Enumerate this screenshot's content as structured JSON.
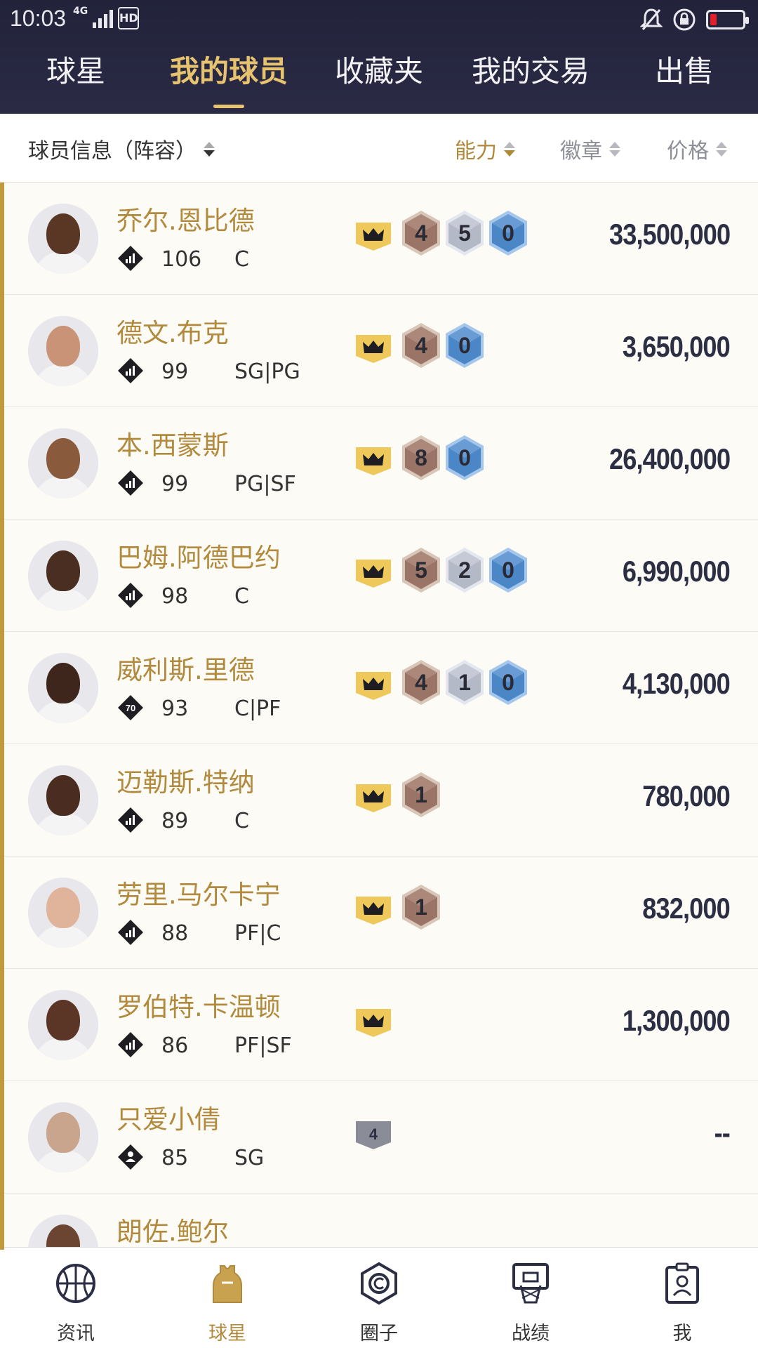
{
  "status_bar": {
    "time": "10:03",
    "network": "4G",
    "hd": "HD"
  },
  "tabs": [
    {
      "label": "球星",
      "active": false
    },
    {
      "label": "我的球员",
      "active": true
    },
    {
      "label": "收藏夹",
      "active": false
    },
    {
      "label": "我的交易",
      "active": false
    },
    {
      "label": "出售",
      "active": false
    }
  ],
  "sortbar": {
    "info": "球员信息（阵容）",
    "ability": "能力",
    "badge": "徽章",
    "price": "价格"
  },
  "players": [
    {
      "name": "乔尔.恩比德",
      "ovr": "106",
      "pos": "C",
      "badge": "bars",
      "crown": "gold",
      "hexes": [
        {
          "v": "4",
          "c": "bronze"
        },
        {
          "v": "5",
          "c": "silver"
        },
        {
          "v": "0",
          "c": "blue"
        }
      ],
      "price": "33,500,000",
      "skin": "#5a3625"
    },
    {
      "name": "德文.布克",
      "ovr": "99",
      "pos": "SG|PG",
      "badge": "bars",
      "crown": "gold",
      "hexes": [
        {
          "v": "4",
          "c": "bronze"
        },
        {
          "v": "0",
          "c": "blue"
        }
      ],
      "price": "3,650,000",
      "skin": "#c99377"
    },
    {
      "name": "本.西蒙斯",
      "ovr": "99",
      "pos": "PG|SF",
      "badge": "bars",
      "crown": "gold",
      "hexes": [
        {
          "v": "8",
          "c": "bronze"
        },
        {
          "v": "0",
          "c": "blue"
        }
      ],
      "price": "26,400,000",
      "skin": "#8a5a3c"
    },
    {
      "name": "巴姆.阿德巴约",
      "ovr": "98",
      "pos": "C",
      "badge": "bars",
      "crown": "gold",
      "hexes": [
        {
          "v": "5",
          "c": "bronze"
        },
        {
          "v": "2",
          "c": "silver"
        },
        {
          "v": "0",
          "c": "blue"
        }
      ],
      "price": "6,990,000",
      "skin": "#4b2e22"
    },
    {
      "name": "威利斯.里德",
      "ovr": "93",
      "pos": "C|PF",
      "badge": "70",
      "crown": "gold",
      "hexes": [
        {
          "v": "4",
          "c": "bronze"
        },
        {
          "v": "1",
          "c": "silver"
        },
        {
          "v": "0",
          "c": "blue"
        }
      ],
      "price": "4,130,000",
      "skin": "#3e261c"
    },
    {
      "name": "迈勒斯.特纳",
      "ovr": "89",
      "pos": "C",
      "badge": "bars",
      "crown": "gold",
      "hexes": [
        {
          "v": "1",
          "c": "bronze"
        }
      ],
      "price": "780,000",
      "skin": "#4a2c20"
    },
    {
      "name": "劳里.马尔卡宁",
      "ovr": "88",
      "pos": "PF|C",
      "badge": "bars",
      "crown": "gold",
      "hexes": [
        {
          "v": "1",
          "c": "bronze"
        }
      ],
      "price": "832,000",
      "skin": "#e0b49a"
    },
    {
      "name": "罗伯特.卡温顿",
      "ovr": "86",
      "pos": "PF|SF",
      "badge": "bars",
      "crown": "gold",
      "hexes": [],
      "price": "1,300,000",
      "skin": "#5b3526"
    },
    {
      "name": "只爱小倩",
      "ovr": "85",
      "pos": "SG",
      "badge": "person",
      "crown": "gray",
      "crown_level": "4",
      "hexes": [],
      "price": "--",
      "skin": "#c9a58d"
    },
    {
      "name": "朗佐.鲍尔",
      "ovr": "",
      "pos": "",
      "badge": "bars",
      "crown": "gold",
      "hexes": [],
      "price": "",
      "skin": "#6b4532"
    }
  ],
  "bottom_nav": [
    {
      "label": "资讯",
      "icon": "basketball-icon",
      "active": false
    },
    {
      "label": "球星",
      "icon": "jersey-icon",
      "active": true
    },
    {
      "label": "圈子",
      "icon": "circle-icon",
      "active": false
    },
    {
      "label": "战绩",
      "icon": "hoop-icon",
      "active": false
    },
    {
      "label": "我",
      "icon": "profile-icon",
      "active": false
    }
  ],
  "colors": {
    "header": "#22233a",
    "gold": "#b28a3d",
    "tab_active": "#e7c36f",
    "price": "#2c2e44"
  }
}
